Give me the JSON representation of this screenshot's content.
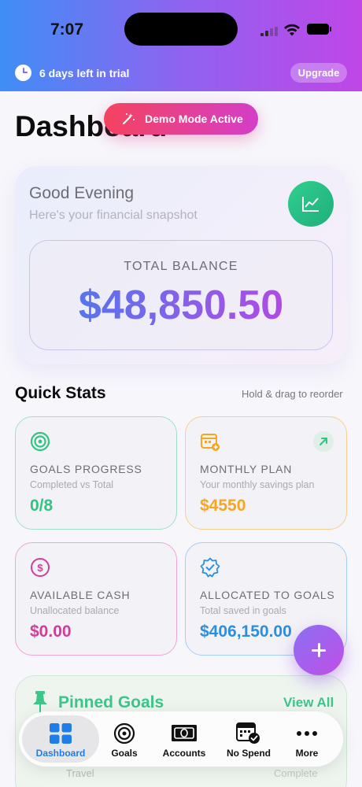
{
  "status_bar": {
    "time": "7:07"
  },
  "trial_banner": {
    "text": "6 days left in trial",
    "upgrade_label": "Upgrade"
  },
  "page": {
    "title": "Dashboard",
    "demo_badge": "Demo Mode Active"
  },
  "hero": {
    "greeting": "Good Evening",
    "subtitle": "Here's your financial snapshot",
    "balance_label": "TOTAL BALANCE",
    "balance_value": "$48,850.50",
    "chart_icon": "trend-chart-icon"
  },
  "quick_stats": {
    "title": "Quick Stats",
    "hint": "Hold & drag to reorder",
    "cards": [
      {
        "icon": "target-icon",
        "label": "GOALS PROGRESS",
        "sub": "Completed vs Total",
        "value": "0/8",
        "color": "#33c383"
      },
      {
        "icon": "calendar-add-icon",
        "label": "MONTHLY PLAN",
        "sub": "Your monthly savings plan",
        "value": "$4550",
        "color": "#f5a623"
      },
      {
        "icon": "dollar-circle-icon",
        "label": "AVAILABLE CASH",
        "sub": "Unallocated balance",
        "value": "$0.00",
        "color": "#d23c9c"
      },
      {
        "icon": "verified-badge-icon",
        "label": "ALLOCATED TO GOALS",
        "sub": "Total saved in goals",
        "value": "$406,150.00",
        "color": "#2b8fe0"
      }
    ]
  },
  "pinned": {
    "title": "Pinned Goals",
    "view_all": "View All",
    "peek_left": "Travel",
    "peek_right": "Complete"
  },
  "tabs": [
    {
      "label": "Dashboard",
      "icon": "grid-icon",
      "active": true
    },
    {
      "label": "Goals",
      "icon": "target-icon",
      "active": false
    },
    {
      "label": "Accounts",
      "icon": "banknote-icon",
      "active": false
    },
    {
      "label": "No Spend",
      "icon": "calendar-check-icon",
      "active": false
    },
    {
      "label": "More",
      "icon": "ellipsis-icon",
      "active": false
    }
  ],
  "colors": {
    "header_gradient": [
      "#3f8ef6",
      "#c046e8"
    ],
    "accent_green": "#3dc58a",
    "accent_purple": "#9a5ef0",
    "active_tab": "#1f7de6"
  }
}
